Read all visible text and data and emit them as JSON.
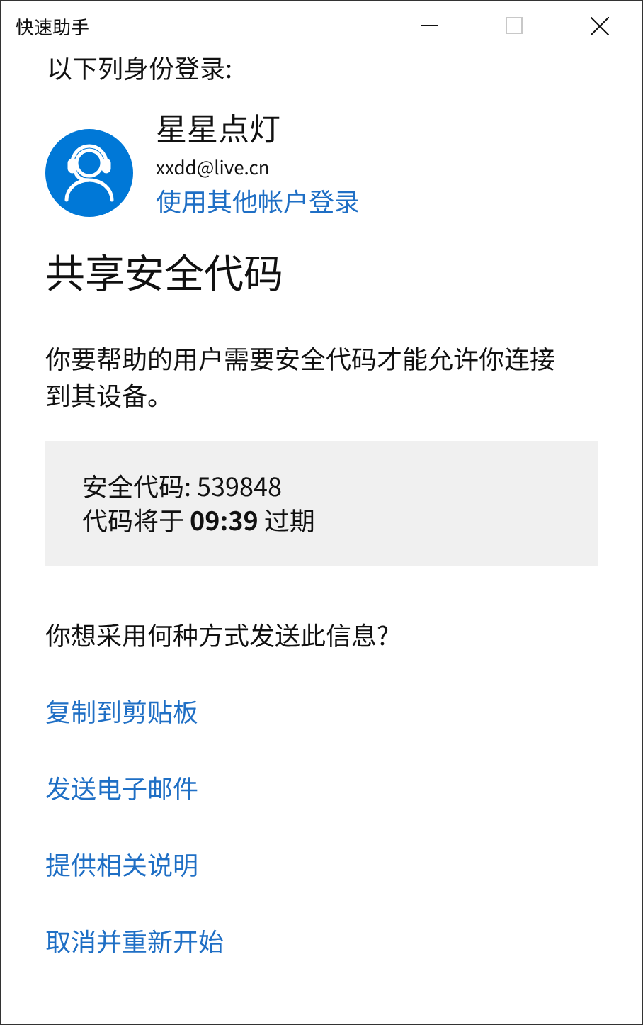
{
  "window": {
    "title": "快速助手",
    "controls": [
      {
        "kind": "minimize"
      },
      {
        "kind": "maximize"
      },
      {
        "kind": "close"
      }
    ]
  },
  "signin": {
    "label": "以下列身份登录:",
    "name": "星星点灯",
    "email": "xxdd@live.cn",
    "switch_link": "使用其他帐户登录"
  },
  "heading": "共享安全代码",
  "description": "你要帮助的用户需要安全代码才能允许你连接到其设备。",
  "code_box": {
    "code_line": "安全代码: 539848",
    "expiry_line": "代码将于 **09:39** 过期"
  },
  "question": "你想采用何种方式发送此信息?",
  "actions": [
    "复制到剪贴板",
    "发送电子邮件",
    "提供相关说明",
    "取消并重新开始"
  ]
}
